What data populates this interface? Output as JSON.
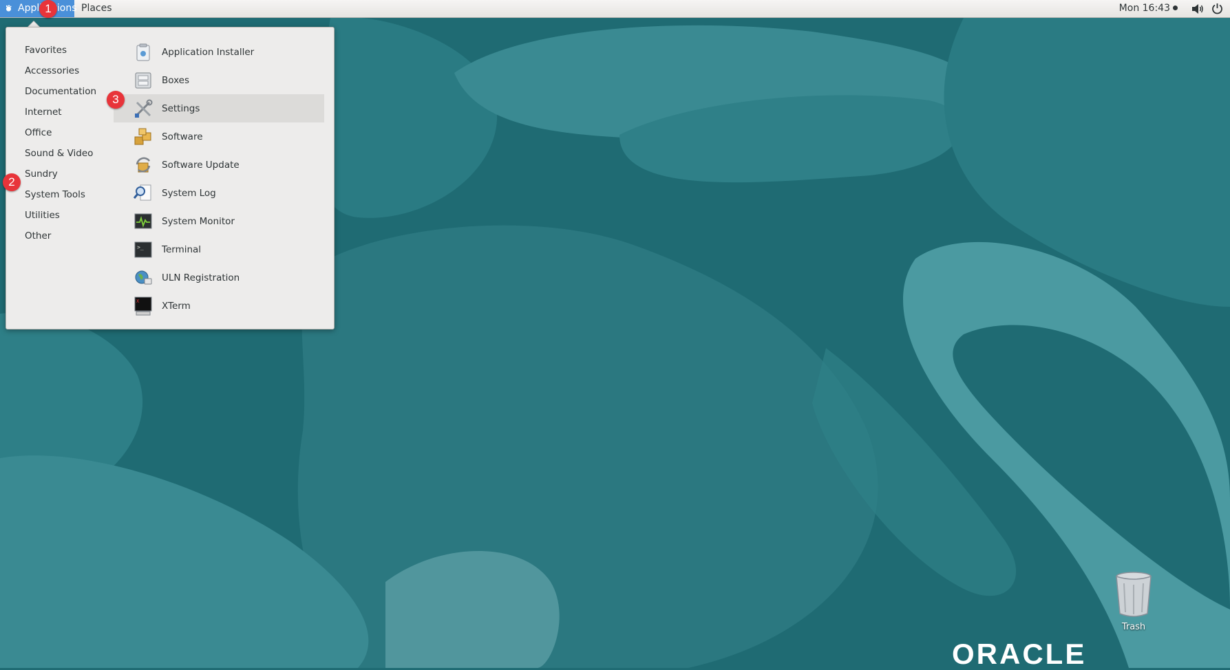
{
  "topbar": {
    "applications_label": "Applications",
    "places_label": "Places",
    "clock": "Mon 16:43"
  },
  "menu": {
    "categories": [
      {
        "label": "Favorites"
      },
      {
        "label": "Accessories"
      },
      {
        "label": "Documentation"
      },
      {
        "label": "Internet"
      },
      {
        "label": "Office"
      },
      {
        "label": "Sound & Video"
      },
      {
        "label": "Sundry"
      },
      {
        "label": "System Tools"
      },
      {
        "label": "Utilities"
      },
      {
        "label": "Other"
      }
    ],
    "apps": [
      {
        "label": "Application Installer",
        "icon": "application-installer-icon"
      },
      {
        "label": "Boxes",
        "icon": "boxes-icon"
      },
      {
        "label": "Settings",
        "icon": "settings-icon"
      },
      {
        "label": "Software",
        "icon": "software-icon"
      },
      {
        "label": "Software Update",
        "icon": "software-update-icon"
      },
      {
        "label": "System Log",
        "icon": "system-log-icon"
      },
      {
        "label": "System Monitor",
        "icon": "system-monitor-icon"
      },
      {
        "label": "Terminal",
        "icon": "terminal-icon"
      },
      {
        "label": "ULN Registration",
        "icon": "uln-registration-icon"
      },
      {
        "label": "XTerm",
        "icon": "xterm-icon"
      }
    ],
    "hovered_app": "Settings"
  },
  "callouts": {
    "one": "1",
    "two": "2",
    "three": "3"
  },
  "desktop": {
    "trash_label": "Trash",
    "logo_text": "ORACLE"
  },
  "colors": {
    "panel_highlight": "#4a90d9",
    "callout": "#e8343a",
    "desktop_dark": "#1f6b73",
    "desktop_light": "#3e8e96"
  }
}
